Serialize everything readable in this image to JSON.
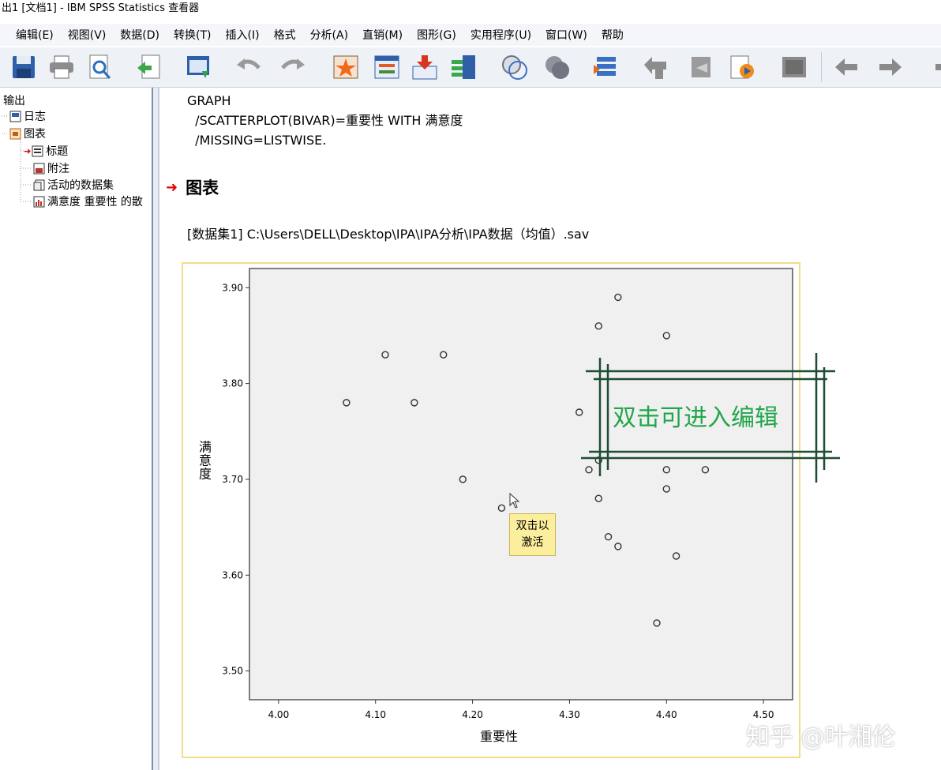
{
  "window": {
    "title": "出1 [文档1] - IBM SPSS Statistics 查看器"
  },
  "menu": [
    "编辑(E)",
    "视图(V)",
    "数据(D)",
    "转换(T)",
    "插入(I)",
    "格式",
    "分析(A)",
    "直销(M)",
    "图形(G)",
    "实用程序(U)",
    "窗口(W)",
    "帮助"
  ],
  "toolbar": {
    "icons": [
      "save-icon",
      "print-icon",
      "print-preview-icon",
      "export-icon",
      "recall-dialog-icon",
      "undo-icon",
      "redo-icon",
      "goto-data-icon",
      "goto-case-icon",
      "goto-variable-icon",
      "variables-icon",
      "show-all-icon",
      "hide-icon",
      "designate-window-icon",
      "promote-icon",
      "demote-icon",
      "expand-icon",
      "collapse-icon",
      "show-icon",
      "previous-icon",
      "next-icon",
      "more-icon"
    ]
  },
  "outline": {
    "root": "输出",
    "items": [
      {
        "label": "日志",
        "icon": "log-icon"
      },
      {
        "label": "图表",
        "icon": "chart-folder-icon"
      },
      {
        "label": "标题",
        "icon": "title-icon"
      },
      {
        "label": "附注",
        "icon": "notes-icon"
      },
      {
        "label": "活动的数据集",
        "icon": "dataset-icon"
      },
      {
        "label": "满意度 重要性 的散",
        "icon": "scatter-icon"
      }
    ]
  },
  "syntax": [
    "GRAPH",
    "  /SCATTERPLOT(BIVAR)=重要性 WITH 满意度",
    "  /MISSING=LISTWISE."
  ],
  "section": {
    "heading": "图表"
  },
  "dataset_line": "[数据集1] C:\\Users\\DELL\\Desktop\\IPA\\IPA分析\\IPA数据（均值）.sav",
  "tooltip": {
    "line1": "双击以",
    "line2": "激活"
  },
  "annotation": {
    "text": "双击可进入编辑",
    "color": "#21a64a"
  },
  "watermark": "知乎 @叶湘伦",
  "chart_data": {
    "type": "scatter",
    "xlabel": "重要性",
    "ylabel": "满意度",
    "xlim": [
      3.97,
      4.53
    ],
    "ylim": [
      3.47,
      3.92
    ],
    "xticks": [
      "4.00",
      "4.10",
      "4.20",
      "4.30",
      "4.40",
      "4.50"
    ],
    "yticks": [
      "3.50",
      "3.60",
      "3.70",
      "3.80",
      "3.90"
    ],
    "grid": false,
    "plot_bg": "#f0f0f0",
    "points": [
      [
        4.07,
        3.78
      ],
      [
        4.11,
        3.83
      ],
      [
        4.14,
        3.78
      ],
      [
        4.17,
        3.83
      ],
      [
        4.19,
        3.7
      ],
      [
        4.23,
        3.67
      ],
      [
        4.31,
        3.77
      ],
      [
        4.32,
        3.71
      ],
      [
        4.33,
        3.72
      ],
      [
        4.33,
        3.68
      ],
      [
        4.33,
        3.86
      ],
      [
        4.34,
        3.64
      ],
      [
        4.35,
        3.63
      ],
      [
        4.35,
        3.89
      ],
      [
        4.39,
        3.55
      ],
      [
        4.4,
        3.85
      ],
      [
        4.4,
        3.71
      ],
      [
        4.4,
        3.69
      ],
      [
        4.41,
        3.62
      ],
      [
        4.44,
        3.71
      ]
    ]
  }
}
